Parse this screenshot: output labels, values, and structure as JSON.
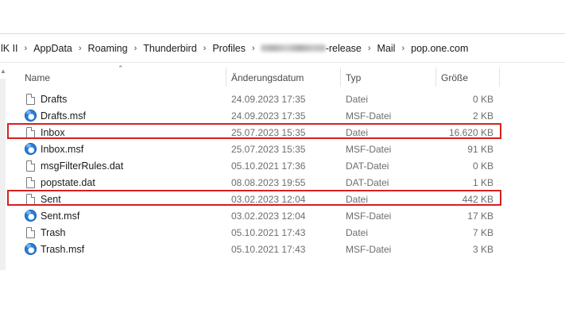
{
  "breadcrumb": {
    "items": [
      "lK II",
      "AppData",
      "Roaming",
      "Thunderbird",
      "Profiles"
    ],
    "profile_suffix": "-release",
    "items_after": [
      "Mail",
      "pop.one.com"
    ],
    "separator": "›"
  },
  "columns": {
    "name": "Name",
    "modified": "Änderungsdatum",
    "type": "Typ",
    "size": "Größe"
  },
  "files": [
    {
      "name": "Drafts",
      "modified": "24.09.2023 17:35",
      "type": "Datei",
      "size": "0 KB",
      "icon": "file-icon"
    },
    {
      "name": "Drafts.msf",
      "modified": "24.09.2023 17:35",
      "type": "MSF-Datei",
      "size": "2 KB",
      "icon": "thunderbird-icon"
    },
    {
      "name": "Inbox",
      "modified": "25.07.2023 15:35",
      "type": "Datei",
      "size": "16.620 KB",
      "icon": "file-icon",
      "highlighted": true
    },
    {
      "name": "Inbox.msf",
      "modified": "25.07.2023 15:35",
      "type": "MSF-Datei",
      "size": "91 KB",
      "icon": "thunderbird-icon"
    },
    {
      "name": "msgFilterRules.dat",
      "modified": "05.10.2021 17:36",
      "type": "DAT-Datei",
      "size": "0 KB",
      "icon": "file-icon"
    },
    {
      "name": "popstate.dat",
      "modified": "08.08.2023 19:55",
      "type": "DAT-Datei",
      "size": "1 KB",
      "icon": "file-icon"
    },
    {
      "name": "Sent",
      "modified": "03.02.2023 12:04",
      "type": "Datei",
      "size": "442 KB",
      "icon": "file-icon",
      "highlighted": true
    },
    {
      "name": "Sent.msf",
      "modified": "03.02.2023 12:04",
      "type": "MSF-Datei",
      "size": "17 KB",
      "icon": "thunderbird-icon"
    },
    {
      "name": "Trash",
      "modified": "05.10.2021 17:43",
      "type": "Datei",
      "size": "7 KB",
      "icon": "file-icon"
    },
    {
      "name": "Trash.msf",
      "modified": "05.10.2021 17:43",
      "type": "MSF-Datei",
      "size": "3 KB",
      "icon": "thunderbird-icon"
    }
  ],
  "colors": {
    "highlight": "#d42121",
    "thunderbird_blue": "#2a7fd6"
  }
}
